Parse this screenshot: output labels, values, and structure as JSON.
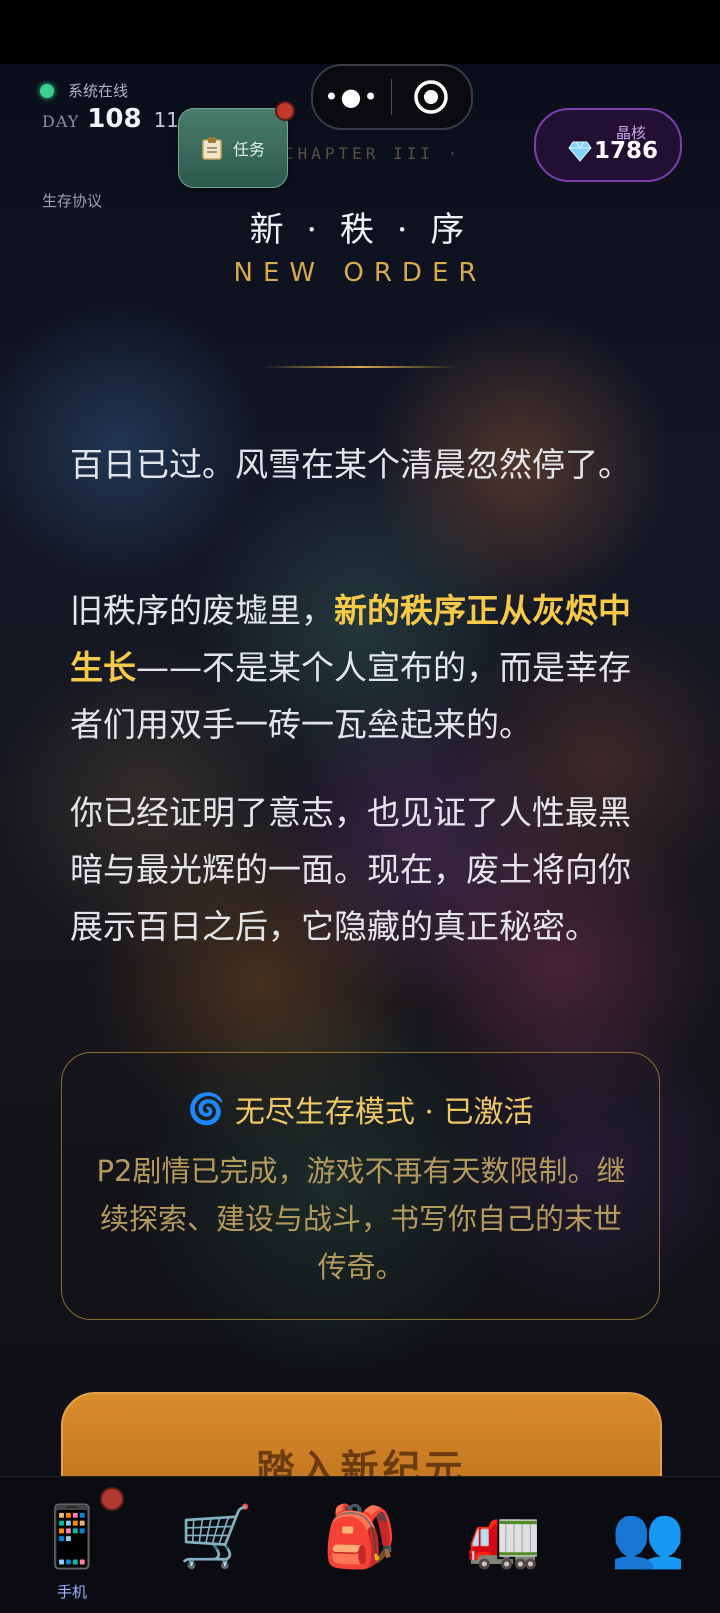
{
  "header": {
    "status_text": "系统在线",
    "day_label": "DAY",
    "day_number": "108",
    "hour": "11",
    "protocol_label": "生存协议"
  },
  "task_button": {
    "label": "任务"
  },
  "capsule": {
    "more_symbol": "•●•"
  },
  "crystal": {
    "label": "晶核",
    "value": "1786"
  },
  "chapter": {
    "subtitle": "CHAPTER III ·",
    "title_cn": "新 · 秩 · 序",
    "title_en": "NEW ORDER"
  },
  "story": {
    "p1": "百日已过。风雪在某个清晨忽然停了。",
    "p2_before": "旧秩序的废墟里，",
    "p2_highlight": "新的秩序正从灰烬中生长",
    "p2_after": "——不是某个人宣布的，而是幸存者们用双手一砖一瓦垒起来的。",
    "p3": "你已经证明了意志，也见证了人性最黑暗与最光辉的一面。现在，废土将向你展示百日之后，它隐藏的真正秘密。"
  },
  "mode_card": {
    "icon": "🌀",
    "title": "无尽生存模式 · 已激活",
    "description": "P2剧情已完成，游戏不再有天数限制。继续探索、建设与战斗，书写你自己的末世传奇。"
  },
  "enter_button": {
    "label": "踏入新纪元"
  },
  "tabbar": {
    "tabs": [
      {
        "icon": "📱",
        "label": "手机"
      },
      {
        "icon": "🛒",
        "label": ""
      },
      {
        "icon": "🎒",
        "label": ""
      },
      {
        "icon": "🚛",
        "label": ""
      },
      {
        "icon": "👥",
        "label": ""
      }
    ]
  },
  "colors": {
    "accent_gold": "#d7aa4b",
    "highlight": "#f6c948",
    "status_online": "#3bd08e",
    "crystal_border": "#7a3fb0"
  }
}
